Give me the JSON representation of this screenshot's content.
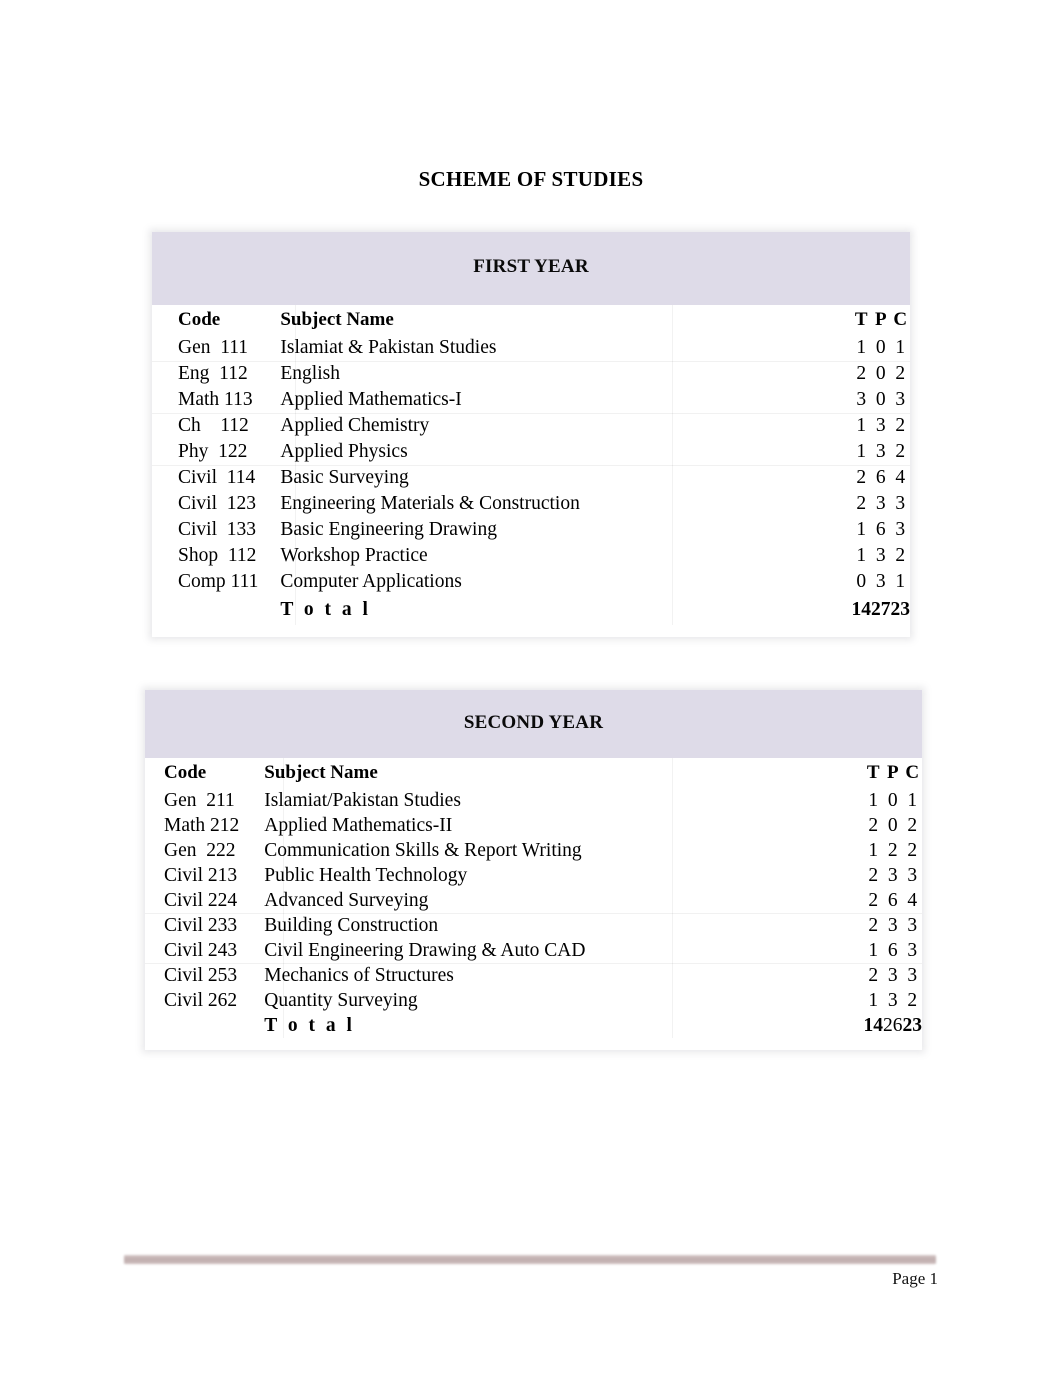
{
  "document": {
    "title": "SCHEME OF STUDIES",
    "page_label": "Page 1",
    "accent_banner_color": "#dedbe8",
    "footer_rule_color": "#c4b2b2"
  },
  "columns": {
    "code": "Code",
    "subject": "Subject Name",
    "t": "T",
    "p": "P",
    "c": "C",
    "total": "T o t a l"
  },
  "tables": [
    {
      "year": "FIRST YEAR",
      "rows": [
        {
          "code": "Gen  111",
          "subject": "Islamiat & Pakistan Studies",
          "t": "1",
          "p": "0",
          "c": "1",
          "group_start": false
        },
        {
          "code": "Eng  112",
          "subject": "English",
          "t": "2",
          "p": "0",
          "c": "2",
          "group_start": true
        },
        {
          "code": "Math 113",
          "subject": "Applied Mathematics-I",
          "t": "3",
          "p": "0",
          "c": "3",
          "group_start": false
        },
        {
          "code": "Ch    112",
          "subject": "Applied Chemistry",
          "t": "1",
          "p": "3",
          "c": "2",
          "group_start": true
        },
        {
          "code": "Phy  122",
          "subject": "Applied Physics",
          "t": "1",
          "p": "3",
          "c": "2",
          "group_start": false
        },
        {
          "code": "Civil  114",
          "subject": "Basic Surveying",
          "t": "2",
          "p": "6",
          "c": "4",
          "group_start": true
        },
        {
          "code": "Civil  123",
          "subject": "Engineering Materials & Construction",
          "t": "2",
          "p": "3",
          "c": "3",
          "group_start": false
        },
        {
          "code": "Civil  133",
          "subject": "Basic Engineering Drawing",
          "t": "1",
          "p": "6",
          "c": "3",
          "group_start": false
        },
        {
          "code": "Shop  112",
          "subject": "Workshop Practice",
          "t": "1",
          "p": "3",
          "c": "2",
          "group_start": false
        },
        {
          "code": "Comp 111",
          "subject": "Computer Applications",
          "t": "0",
          "p": "3",
          "c": "1",
          "group_start": false
        }
      ],
      "total": {
        "t": "14",
        "p": "27",
        "c": "23",
        "p_bold": true
      }
    },
    {
      "year": "SECOND YEAR",
      "rows": [
        {
          "code": "Gen  211",
          "subject": "Islamiat/Pakistan Studies",
          "t": "1",
          "p": "0",
          "c": "1",
          "group_start": false
        },
        {
          "code": "Math 212",
          "subject": "Applied Mathematics-II",
          "t": "2",
          "p": "0",
          "c": "2",
          "group_start": false
        },
        {
          "code": "Gen  222",
          "subject": "Communication Skills  & Report Writing",
          "t": "1",
          "p": "2",
          "c": "2",
          "group_start": false
        },
        {
          "code": "Civil 213",
          "subject": "Public Health Technology",
          "t": "2",
          "p": "3",
          "c": "3",
          "group_start": false
        },
        {
          "code": "Civil 224",
          "subject": "Advanced Surveying",
          "t": "2",
          "p": "6",
          "c": "4",
          "group_start": false
        },
        {
          "code": "Civil 233",
          "subject": "Building Construction",
          "t": "2",
          "p": "3",
          "c": "3",
          "group_start": true
        },
        {
          "code": "Civil 243",
          "subject": "Civil Engineering Drawing & Auto CAD",
          "t": "1",
          "p": "6",
          "c": "3",
          "group_start": false
        },
        {
          "code": "Civil 253",
          "subject": "Mechanics of Structures",
          "t": "2",
          "p": "3",
          "c": "3",
          "group_start": true
        },
        {
          "code": "Civil 262",
          "subject": "Quantity Surveying",
          "t": "1",
          "p": "3",
          "c": "2",
          "group_start": false
        }
      ],
      "total": {
        "t": "14",
        "p": "26",
        "c": "23",
        "p_bold": false
      }
    }
  ]
}
